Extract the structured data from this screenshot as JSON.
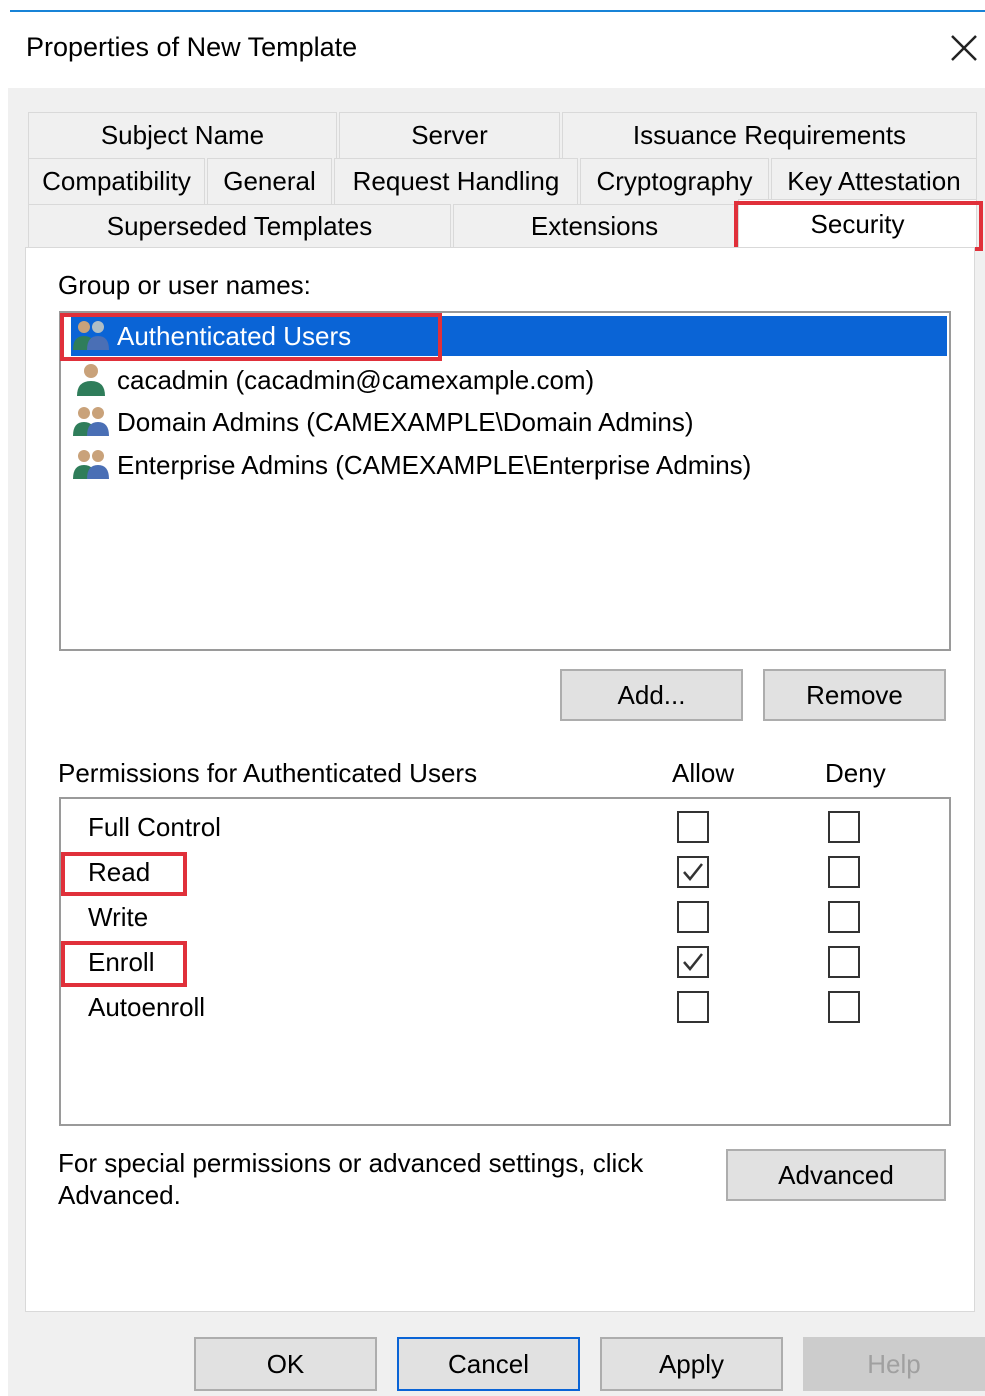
{
  "window": {
    "title": "Properties of New Template",
    "close_glyph": "×"
  },
  "tabs": {
    "row1": [
      "Subject Name",
      "Server",
      "Issuance Requirements"
    ],
    "row2": [
      "Compatibility",
      "General",
      "Request Handling",
      "Cryptography",
      "Key Attestation"
    ],
    "row3": [
      "Superseded Templates",
      "Extensions",
      "Security"
    ],
    "active": "Security"
  },
  "group_section": {
    "label": "Group or user names:",
    "users": [
      {
        "name": "Authenticated Users",
        "icon": "group-users-icon",
        "selected": true
      },
      {
        "name": "cacadmin (cacadmin@camexample.com)",
        "icon": "single-user-icon",
        "selected": false
      },
      {
        "name": "Domain Admins (CAMEXAMPLE\\Domain Admins)",
        "icon": "group-users-icon",
        "selected": false
      },
      {
        "name": "Enterprise Admins (CAMEXAMPLE\\Enterprise Admins)",
        "icon": "group-users-icon",
        "selected": false
      }
    ],
    "add_label": "Add...",
    "remove_label": "Remove"
  },
  "permissions": {
    "label": "Permissions for Authenticated Users",
    "allow_header": "Allow",
    "deny_header": "Deny",
    "rows": [
      {
        "name": "Full Control",
        "allow": false,
        "deny": false
      },
      {
        "name": "Read",
        "allow": true,
        "deny": false
      },
      {
        "name": "Write",
        "allow": false,
        "deny": false
      },
      {
        "name": "Enroll",
        "allow": true,
        "deny": false
      },
      {
        "name": "Autoenroll",
        "allow": false,
        "deny": false
      }
    ]
  },
  "advanced": {
    "text_line1": "For special permissions or advanced settings, click",
    "text_line2": "Advanced.",
    "button_label": "Advanced"
  },
  "footer": {
    "ok_label": "OK",
    "cancel_label": "Cancel",
    "apply_label": "Apply",
    "help_label": "Help"
  },
  "colors": {
    "selection": "#0a64d6",
    "highlight": "#e0303a",
    "accent_line": "#1883d7"
  }
}
